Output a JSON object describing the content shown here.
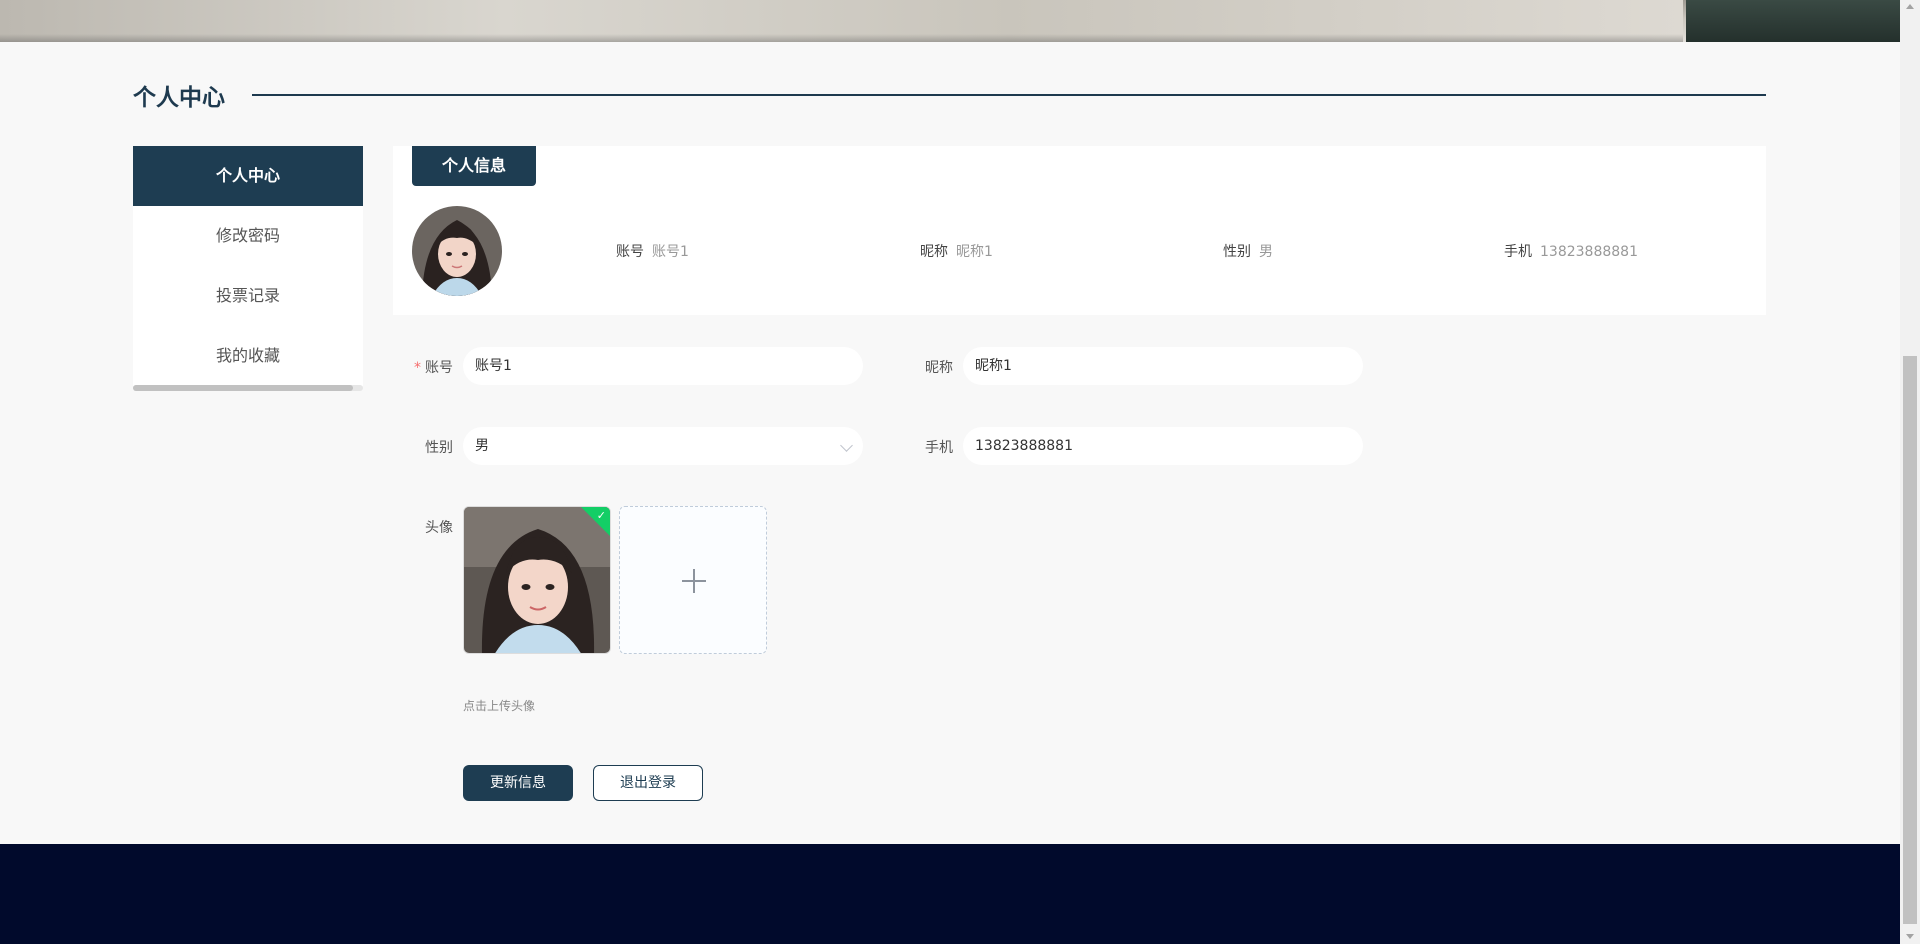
{
  "page": {
    "section_title": "个人中心"
  },
  "sidebar": {
    "items": [
      {
        "label": "个人中心"
      },
      {
        "label": "修改密码"
      },
      {
        "label": "投票记录"
      },
      {
        "label": "我的收藏"
      }
    ]
  },
  "info_card": {
    "tab_label": "个人信息",
    "fields": {
      "account": {
        "label": "账号",
        "value": "账号1"
      },
      "nickname": {
        "label": "昵称",
        "value": "昵称1"
      },
      "gender": {
        "label": "性别",
        "value": "男"
      },
      "phone": {
        "label": "手机",
        "value": "13823888881"
      }
    }
  },
  "form": {
    "account": {
      "label": "账号",
      "required_mark": "*",
      "value": "账号1"
    },
    "nickname": {
      "label": "昵称",
      "value": "昵称1"
    },
    "gender": {
      "label": "性别",
      "value": "男"
    },
    "phone": {
      "label": "手机",
      "value": "13823888881"
    },
    "avatar": {
      "label": "头像",
      "upload_tip": "点击上传头像"
    },
    "buttons": {
      "update": "更新信息",
      "logout": "退出登录"
    }
  },
  "colors": {
    "primary": "#1e3d52",
    "footer": "#010a2c",
    "success": "#13ce66",
    "required": "#f56c6c"
  }
}
